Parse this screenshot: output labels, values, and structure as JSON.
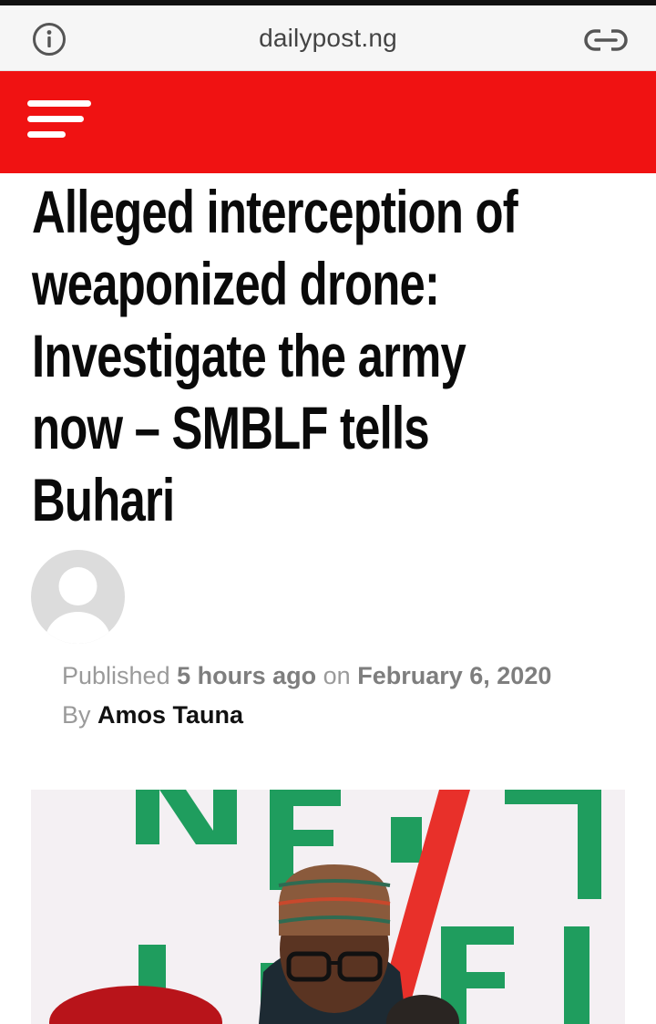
{
  "browser": {
    "url": "dailypost.ng",
    "icons": [
      "info-icon",
      "link-icon"
    ]
  },
  "header": {
    "icons": [
      "hamburger-menu-icon"
    ],
    "accent_color": "#f01212"
  },
  "article": {
    "headline_lines": [
      "Alleged interception of",
      "weaponized drone:",
      "Investigate the army",
      "now – SMBLF tells",
      "Buhari"
    ],
    "meta": {
      "published_label": "Published",
      "relative_time": "5 hours ago",
      "on_label": "on",
      "date": "February 6, 2020",
      "by_label": "By",
      "author": "Amos Tauna"
    },
    "image_text": "NEXT LEVEL"
  }
}
